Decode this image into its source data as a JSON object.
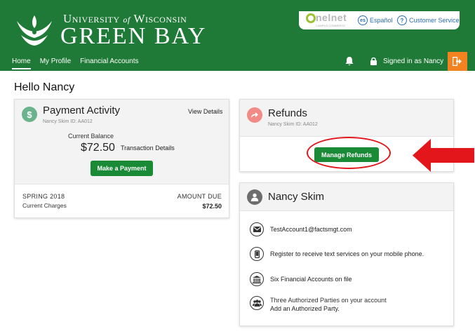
{
  "header": {
    "logo_top": "University",
    "logo_of": "of",
    "logo_top_2": "Wisconsin",
    "logo_bottom": "GREEN BAY",
    "vendor": "nelnet",
    "vendor_sub": "CAMPUS COMMERCE",
    "lang_badge": "es",
    "lang_label": "Español",
    "cs_badge": "?",
    "cs_label": "Customer Service"
  },
  "nav": {
    "items": [
      "Home",
      "My Profile",
      "Financial Accounts"
    ],
    "signed_in": "Signed in as Nancy"
  },
  "greeting": "Hello Nancy",
  "payment_activity": {
    "title": "Payment Activity",
    "subtitle": "Nancy Skim ID: AA012",
    "view_details": "View Details",
    "current_balance_label": "Current Balance",
    "current_balance": "$72.50",
    "transaction_details": "Transaction Details",
    "make_payment": "Make a Payment",
    "term": "SPRING 2018",
    "charges_label": "Current Charges",
    "amount_due_label": "AMOUNT DUE",
    "amount_due": "$72.50"
  },
  "refunds": {
    "title": "Refunds",
    "subtitle": "Nancy Skim ID: AA012",
    "manage_button": "Manage Refunds"
  },
  "profile": {
    "name": "Nancy Skim",
    "email": "TestAccount1@factsmgt.com",
    "text_services": "Register to receive text services on your mobile phone.",
    "financial_accounts": "Six Financial Accounts on file",
    "authorized_parties": "Three Authorized Parties on your account",
    "add_authorized": "Add an Authorized Party."
  },
  "colors": {
    "brand_green": "#1e7a36",
    "button_green": "#1a8a36",
    "logout_orange": "#f38220",
    "annotation_red": "#e3161b"
  },
  "icons": [
    "crest-logo",
    "bell-icon",
    "lock-icon",
    "logout-icon",
    "dollar-icon",
    "refund-arrow-icon",
    "user-icon",
    "envelope-icon",
    "mobile-icon",
    "bank-icon",
    "group-icon"
  ]
}
